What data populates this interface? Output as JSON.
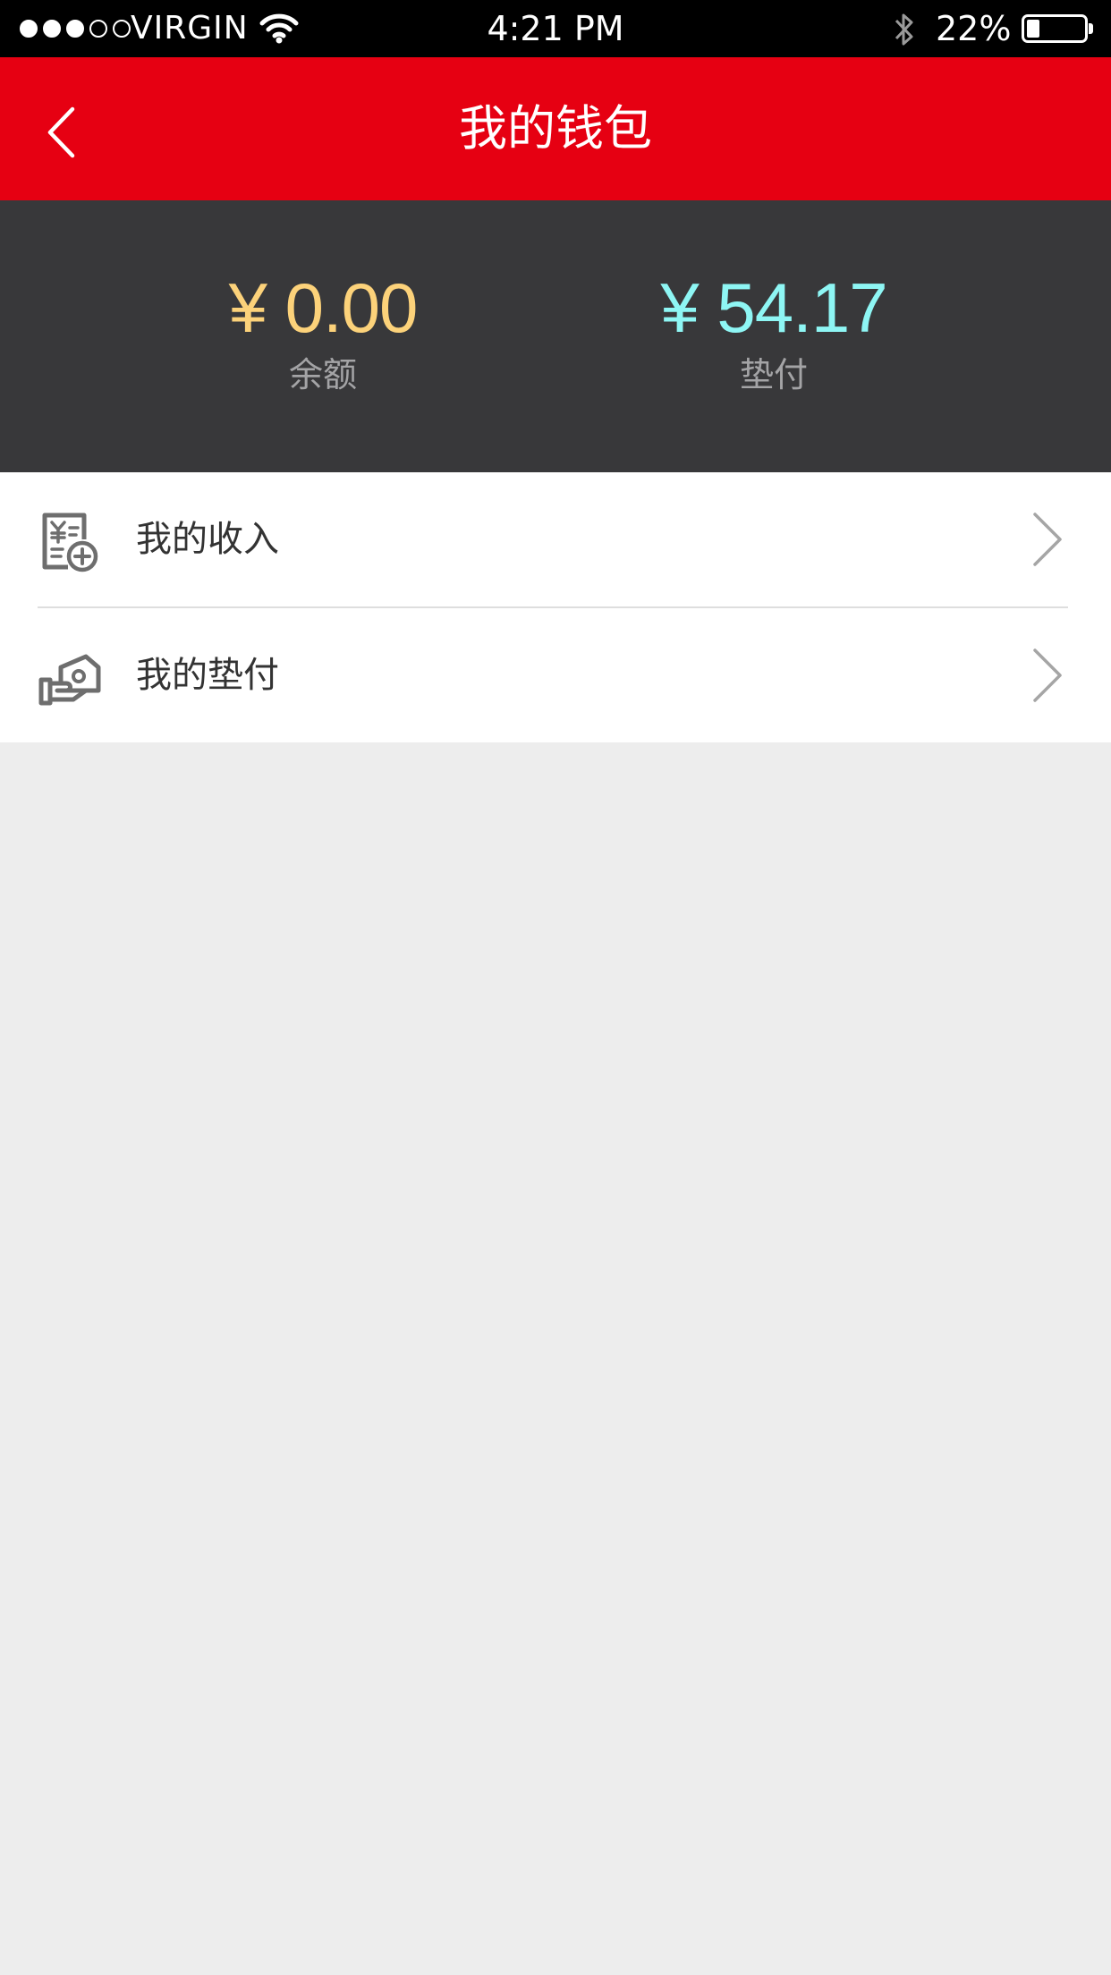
{
  "status_bar": {
    "carrier": "VIRGIN",
    "time": "4:21 PM",
    "battery_percent": "22%",
    "battery_level": 0.22,
    "signal_bars_filled": 3,
    "signal_bars_total": 5
  },
  "nav": {
    "title": "我的钱包",
    "back_icon": "chevron-left-icon"
  },
  "summary": {
    "balance": {
      "amount": "¥ 0.00",
      "label": "余额"
    },
    "advance": {
      "amount": "¥ 54.17",
      "label": "垫付"
    }
  },
  "menu": {
    "items": [
      {
        "label": "我的收入",
        "icon": "income-receipt-icon"
      },
      {
        "label": "我的垫付",
        "icon": "advance-payment-icon"
      }
    ]
  },
  "colors": {
    "nav_background": "#e60012",
    "summary_background": "#38383a",
    "balance_amount": "#fcd27a",
    "advance_amount": "#8ef6f4",
    "page_background": "#ededed"
  }
}
